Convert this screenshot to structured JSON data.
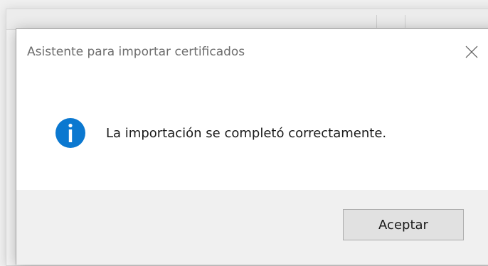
{
  "dialog": {
    "title": "Asistente para importar certificados",
    "message": "La importación se completó correctamente.",
    "ok_label": "Aceptar"
  },
  "icons": {
    "info": "info-icon",
    "close": "close-icon"
  },
  "colors": {
    "info_icon": "#0b78d0",
    "footer_bg": "#f0f0f0",
    "button_bg": "#e1e1e1",
    "button_border": "#adadad",
    "title_text": "#6d6d6d"
  }
}
